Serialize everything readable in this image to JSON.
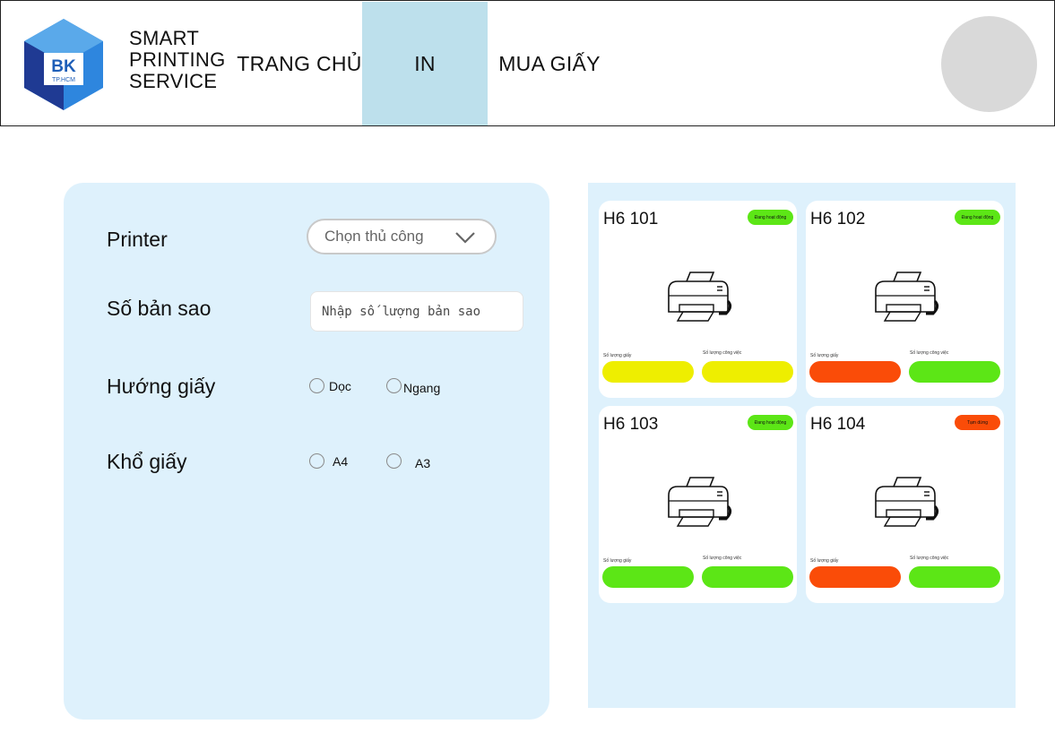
{
  "brand": {
    "logo_text": "BK",
    "logo_sub": "TP.HCM",
    "line1": "SMART",
    "line2": "PRINTING",
    "line3": "SERVICE"
  },
  "nav": {
    "home": "TRANG CHỦ",
    "print": "IN",
    "buy": "MUA GIẤY",
    "active": "IN"
  },
  "form": {
    "printer_label": "Printer",
    "printer_select": "Chọn thủ công",
    "copies_label": "Số bản sao",
    "copies_placeholder": "Nhập số lượng bản sao",
    "orientation_label": "Hướng giấy",
    "orientation_options": [
      "Dọc",
      "Ngang"
    ],
    "size_label": "Khổ giấy",
    "size_options": [
      "A4",
      "A3"
    ]
  },
  "printers": [
    {
      "name": "H6 101",
      "status": "Đang hoạt động",
      "status_color": "#5ce616",
      "paper_label": "Số lượng giấy",
      "jobs_label": "Số lượng công việc",
      "paper_color": "#eeee00",
      "jobs_color": "#eeee00"
    },
    {
      "name": "H6 102",
      "status": "Đang hoạt động",
      "status_color": "#5ce616",
      "paper_label": "Số lượng giấy",
      "jobs_label": "Số lượng công việc",
      "paper_color": "#fa4c08",
      "jobs_color": "#5ce616"
    },
    {
      "name": "H6 103",
      "status": "Đang hoạt động",
      "status_color": "#5ce616",
      "paper_label": "Số lượng giấy",
      "jobs_label": "Số lượng công việc",
      "paper_color": "#5ce616",
      "jobs_color": "#5ce616"
    },
    {
      "name": "H6 104",
      "status": "Tạm dừng",
      "status_color": "#fa4c08",
      "paper_label": "Số lượng giấy",
      "jobs_label": "Số lượng công việc",
      "paper_color": "#fa4c08",
      "jobs_color": "#5ce616"
    }
  ],
  "colors": {
    "nav_active_bg": "#bde0ec",
    "panel_bg": "#def1fc",
    "logo_dark": "#1f3a93",
    "logo_light": "#2e86de"
  }
}
